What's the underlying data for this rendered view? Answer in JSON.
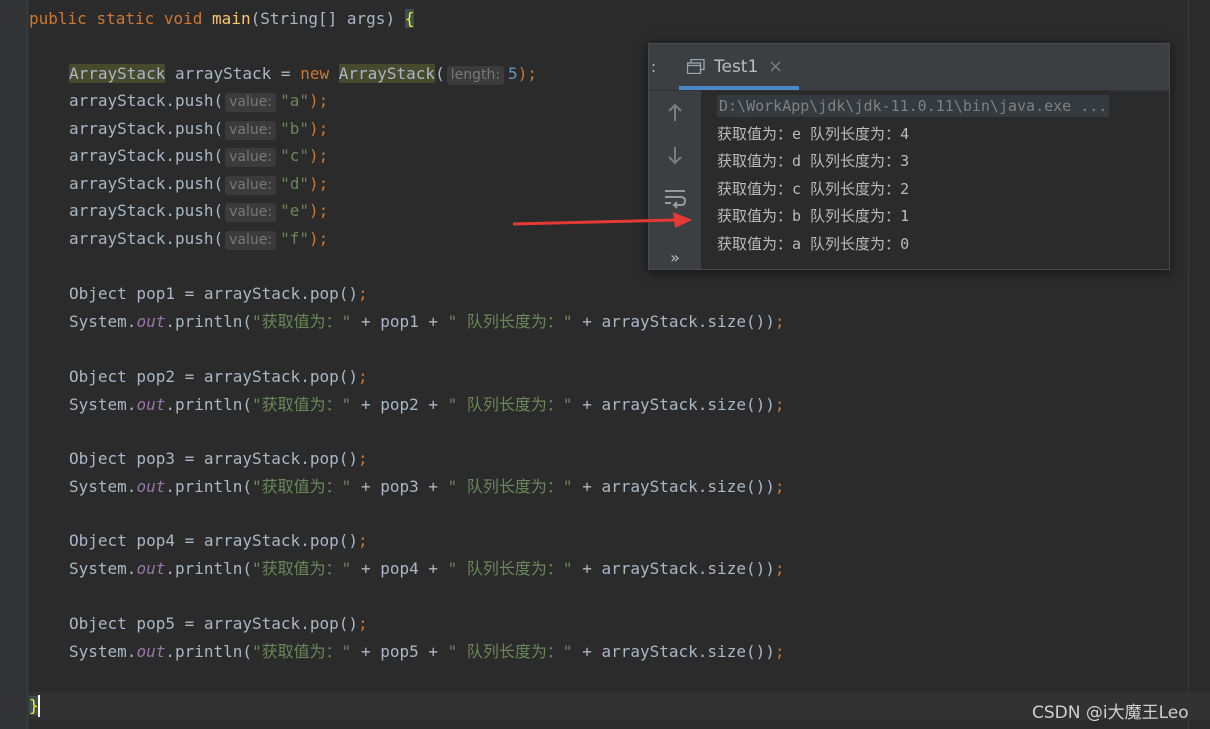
{
  "editor": {
    "line1": {
      "public": "public",
      "static": "static",
      "void": "void",
      "main": "main",
      "params": "(String[] args) ",
      "brace": "{"
    },
    "decl": {
      "type1": "ArrayStack",
      "var": " arrayStack = ",
      "new": "new",
      "type2": "ArrayStack",
      "open": "(",
      "hint": "length:",
      "num": "5",
      "close": ");"
    },
    "push_hint": "value:",
    "push_prefix": "arrayStack.push(",
    "push_values": [
      "\"a\"",
      "\"b\"",
      "\"c\"",
      "\"d\"",
      "\"e\"",
      "\"f\""
    ],
    "push_suffix": ");",
    "pops": [
      {
        "decl": "Object pop1 = arrayStack.pop()",
        "semi": ";",
        "sys": "System.",
        "out": "out",
        "println": ".println(",
        "str1": "\"获取值为：\"",
        "mid": " + pop1 + ",
        "str2": "\" 队列长度为：\"",
        "tail": " + arrayStack.size())",
        "semi2": ";"
      },
      {
        "decl": "Object pop2 = arrayStack.pop()",
        "semi": ";",
        "sys": "System.",
        "out": "out",
        "println": ".println(",
        "str1": "\"获取值为：\"",
        "mid": " + pop2 + ",
        "str2": "\" 队列长度为：\"",
        "tail": " + arrayStack.size())",
        "semi2": ";"
      },
      {
        "decl": "Object pop3 = arrayStack.pop()",
        "semi": ";",
        "sys": "System.",
        "out": "out",
        "println": ".println(",
        "str1": "\"获取值为：\"",
        "mid": " + pop3 + ",
        "str2": "\" 队列长度为：\"",
        "tail": " + arrayStack.size())",
        "semi2": ";"
      },
      {
        "decl": "Object pop4 = arrayStack.pop()",
        "semi": ";",
        "sys": "System.",
        "out": "out",
        "println": ".println(",
        "str1": "\"获取值为：\"",
        "mid": " + pop4 + ",
        "str2": "\" 队列长度为：\"",
        "tail": " + arrayStack.size())",
        "semi2": ";"
      },
      {
        "decl": "Object pop5 = arrayStack.pop()",
        "semi": ";",
        "sys": "System.",
        "out": "out",
        "println": ".println(",
        "str1": "\"获取值为：\"",
        "mid": " + pop5 + ",
        "str2": "\" 队列长度为：\"",
        "tail": " + arrayStack.size())",
        "semi2": ";"
      }
    ],
    "closing_brace": "}"
  },
  "run_panel": {
    "header_cut": ":",
    "tab_title": "Test1",
    "tab_close": "×",
    "tab_icon": "console-window-icon",
    "tools": [
      "up-arrow-icon",
      "down-arrow-icon",
      "soft-wrap-icon",
      "more-icon"
    ],
    "more_label": "»",
    "path": "D:\\WorkApp\\jdk\\jdk-11.0.11\\bin\\java.exe ...",
    "output": [
      "获取值为：e 队列长度为：4",
      "获取值为：d 队列长度为：3",
      "获取值为：c 队列长度为：2",
      "获取值为：b 队列长度为：1",
      "获取值为：a 队列长度为：0"
    ]
  },
  "annotation": {
    "arrow_color": "#e53935"
  },
  "watermark": "CSDN @i大魔王Leo"
}
